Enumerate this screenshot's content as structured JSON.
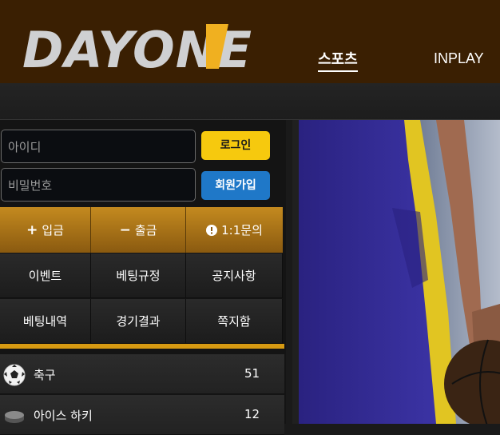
{
  "header": {
    "logo_text": "DAYONE",
    "nav": [
      {
        "label": "스포츠"
      },
      {
        "label": "INPLAY"
      }
    ]
  },
  "login": {
    "id_placeholder": "아이디",
    "pw_placeholder": "비밀번호",
    "login_label": "로그인",
    "join_label": "회원가입"
  },
  "actions": [
    {
      "label": "입금",
      "icon": "plus-icon"
    },
    {
      "label": "출금",
      "icon": "minus-icon"
    },
    {
      "label": "1:1문의",
      "icon": "info-icon"
    }
  ],
  "menu": [
    [
      "이벤트",
      "베팅규정",
      "공지사항"
    ],
    [
      "베팅내역",
      "경기결과",
      "쪽지함"
    ]
  ],
  "sports": [
    {
      "name": "축구",
      "count": "51",
      "icon": "soccer-ball-icon"
    },
    {
      "name": "아이스 하키",
      "count": "12",
      "icon": "hockey-puck-icon"
    }
  ],
  "colors": {
    "header_bg": "#3a1f02",
    "gold": "#d79a12",
    "login_button": "#f6c90e",
    "join_button": "#1f78c8"
  }
}
